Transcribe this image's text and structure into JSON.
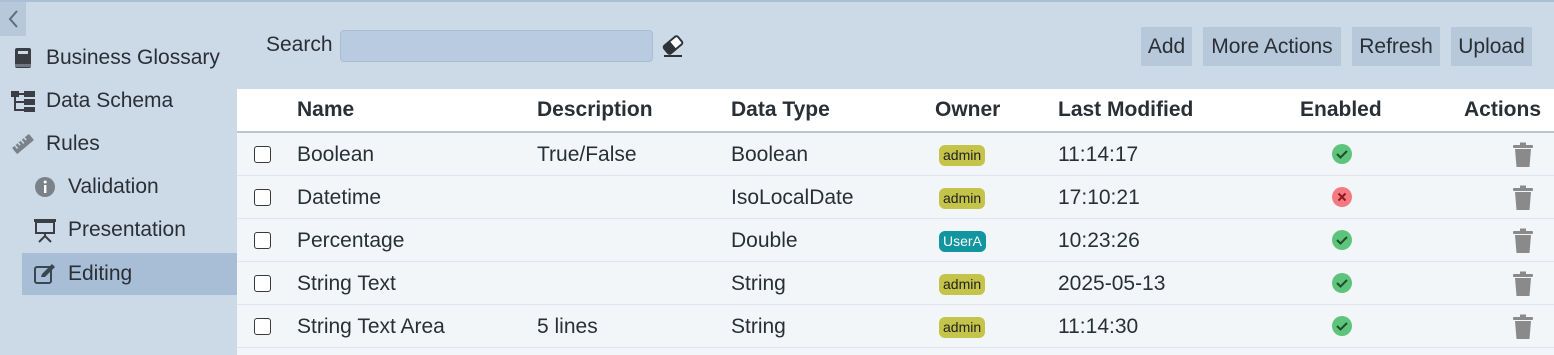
{
  "sidebar": {
    "collapse_icon": "chevron-left-icon",
    "items": [
      {
        "label": "Business Glossary",
        "icon": "book-icon"
      },
      {
        "label": "Data Schema",
        "icon": "hierarchy-icon"
      },
      {
        "label": "Rules",
        "icon": "ruler-icon"
      },
      {
        "label": "Validation",
        "icon": "info-icon"
      },
      {
        "label": "Presentation",
        "icon": "presentation-board-icon"
      },
      {
        "label": "Editing",
        "icon": "edit-icon",
        "active": true
      }
    ]
  },
  "toolbar": {
    "search_label": "Search",
    "search_value": "",
    "search_placeholder": "",
    "clear_icon": "eraser-icon",
    "add_label": "Add",
    "more_actions_label": "More Actions",
    "refresh_label": "Refresh",
    "upload_label": "Upload"
  },
  "table": {
    "columns": {
      "name": "Name",
      "description": "Description",
      "data_type": "Data Type",
      "owner": "Owner",
      "last_modified": "Last Modified",
      "enabled": "Enabled",
      "actions": "Actions"
    },
    "rows": [
      {
        "name": "Boolean",
        "description": "True/False",
        "data_type": "Boolean",
        "owner": "admin",
        "last_modified": "11:14:17",
        "enabled": true
      },
      {
        "name": "Datetime",
        "description": "",
        "data_type": "IsoLocalDate",
        "owner": "admin",
        "last_modified": "17:10:21",
        "enabled": false
      },
      {
        "name": "Percentage",
        "description": "",
        "data_type": "Double",
        "owner": "UserA",
        "last_modified": "10:23:26",
        "enabled": true
      },
      {
        "name": "String Text",
        "description": "",
        "data_type": "String",
        "owner": "admin",
        "last_modified": "2025-05-13",
        "enabled": true
      },
      {
        "name": "String Text Area",
        "description": "5 lines",
        "data_type": "String",
        "owner": "admin",
        "last_modified": "11:14:30",
        "enabled": true
      }
    ],
    "row_action_icon": "trash-icon",
    "enabled_icon": "check-circle-icon",
    "disabled_icon": "x-circle-icon"
  },
  "colors": {
    "background": "#ccdae8",
    "active_nav": "#a8bed6",
    "button": "#b6c8da",
    "admin_badge": "#c5c44a",
    "user_badge": "#11959f",
    "enabled": "#5ec47b",
    "disabled": "#f47a80",
    "trash": "#8a8a8a"
  }
}
